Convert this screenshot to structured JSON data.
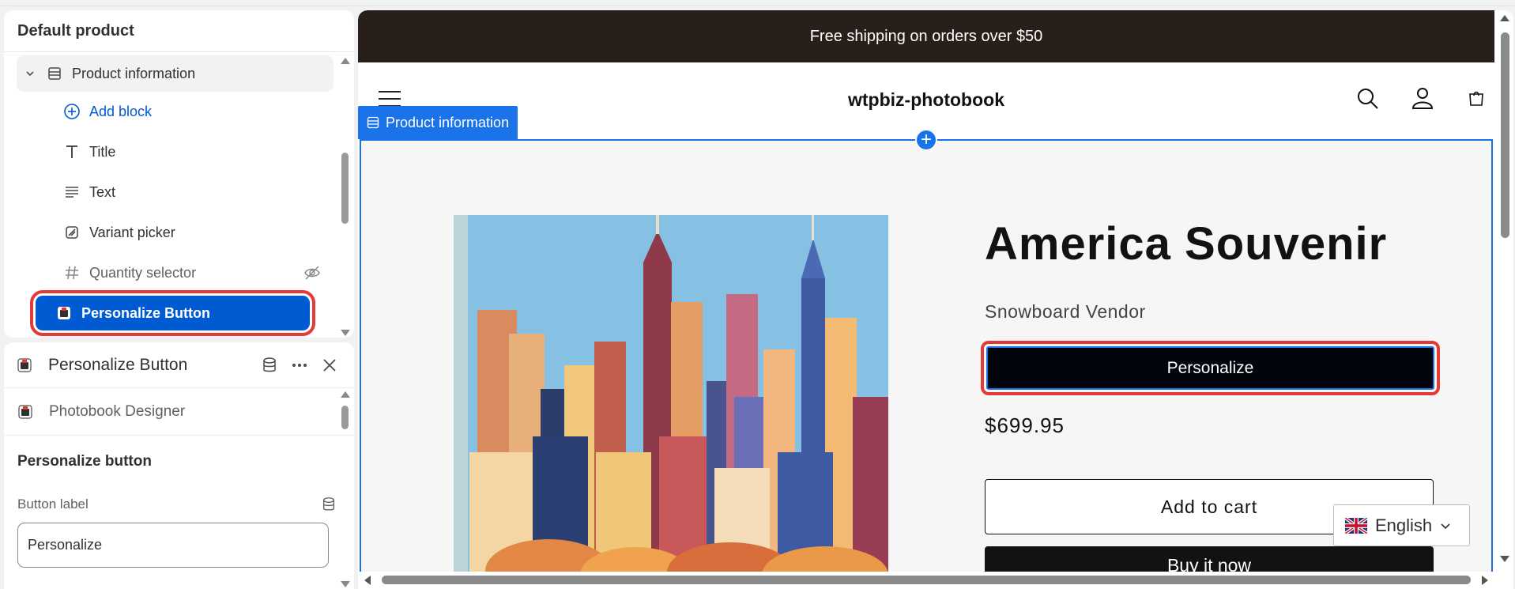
{
  "structure_panel": {
    "title": "Default product",
    "group": {
      "label": "Product information",
      "icon": "section-icon",
      "expanded": true
    },
    "items": [
      {
        "label": "Add block",
        "icon": "plus-circle-icon",
        "kind": "add"
      },
      {
        "label": "Title",
        "icon": "text-title-icon"
      },
      {
        "label": "Text",
        "icon": "text-lines-icon"
      },
      {
        "label": "Variant picker",
        "icon": "variant-icon"
      },
      {
        "label": "Quantity selector",
        "icon": "hash-icon",
        "hidden": true,
        "status_icon": "eye-off-icon"
      },
      {
        "label": "Personalize Button",
        "icon": "app-block-icon",
        "selected": true
      }
    ]
  },
  "settings_panel": {
    "title": "Personalize Button",
    "header_actions": [
      "database-icon",
      "more-horizontal-icon",
      "close-icon"
    ],
    "app_name": "Photobook Designer",
    "section_title": "Personalize button",
    "field": {
      "label": "Button label",
      "value": "Personalize",
      "label_icon": "database-icon"
    }
  },
  "preview": {
    "announcement": "Free shipping on orders over $50",
    "store_name": "wtpbiz-photobook",
    "header_icons": [
      "menu-icon",
      "search-icon",
      "account-icon",
      "cart-icon"
    ],
    "section_tag": "Product information",
    "product": {
      "title": "America Souvenir",
      "vendor": "Snowboard Vendor",
      "personalize_label": "Personalize",
      "price": "$699.95",
      "add_to_cart_label": "Add to cart",
      "buy_label": "Buy it now"
    },
    "language": "English"
  },
  "colors": {
    "accent": "#005bd3",
    "editor_selection": "#1a73e8",
    "highlight": "#e53935",
    "announcement_bg": "#281f1b"
  }
}
